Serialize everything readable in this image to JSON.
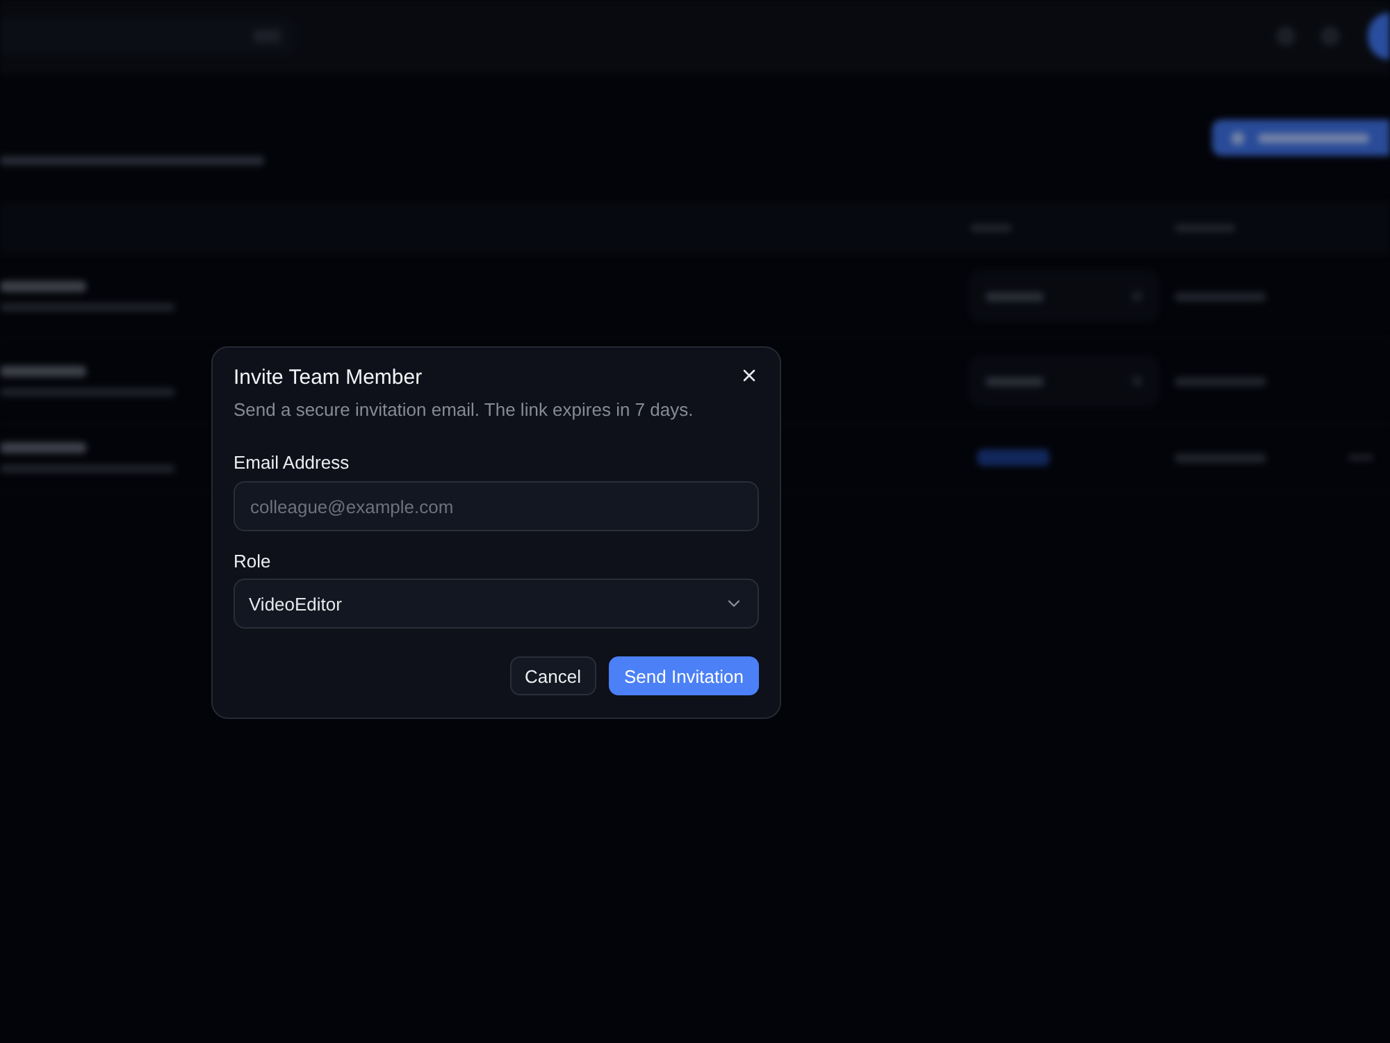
{
  "backdrop": {
    "table_rows": [
      {
        "kind": "select",
        "has_menu": false
      },
      {
        "kind": "select",
        "has_menu": false
      },
      {
        "kind": "badge",
        "has_menu": true
      }
    ]
  },
  "dialog": {
    "title": "Invite Team Member",
    "description": "Send a secure invitation email. The link expires in 7 days.",
    "fields": [
      {
        "kind": "input",
        "label": "Email Address",
        "placeholder": "colleague@example.com"
      },
      {
        "kind": "select",
        "label": "Role",
        "value": "VideoEditor"
      }
    ],
    "buttons": [
      {
        "kind": "secondary",
        "label": "Cancel"
      },
      {
        "kind": "primary",
        "label": "Send Invitation"
      }
    ]
  }
}
